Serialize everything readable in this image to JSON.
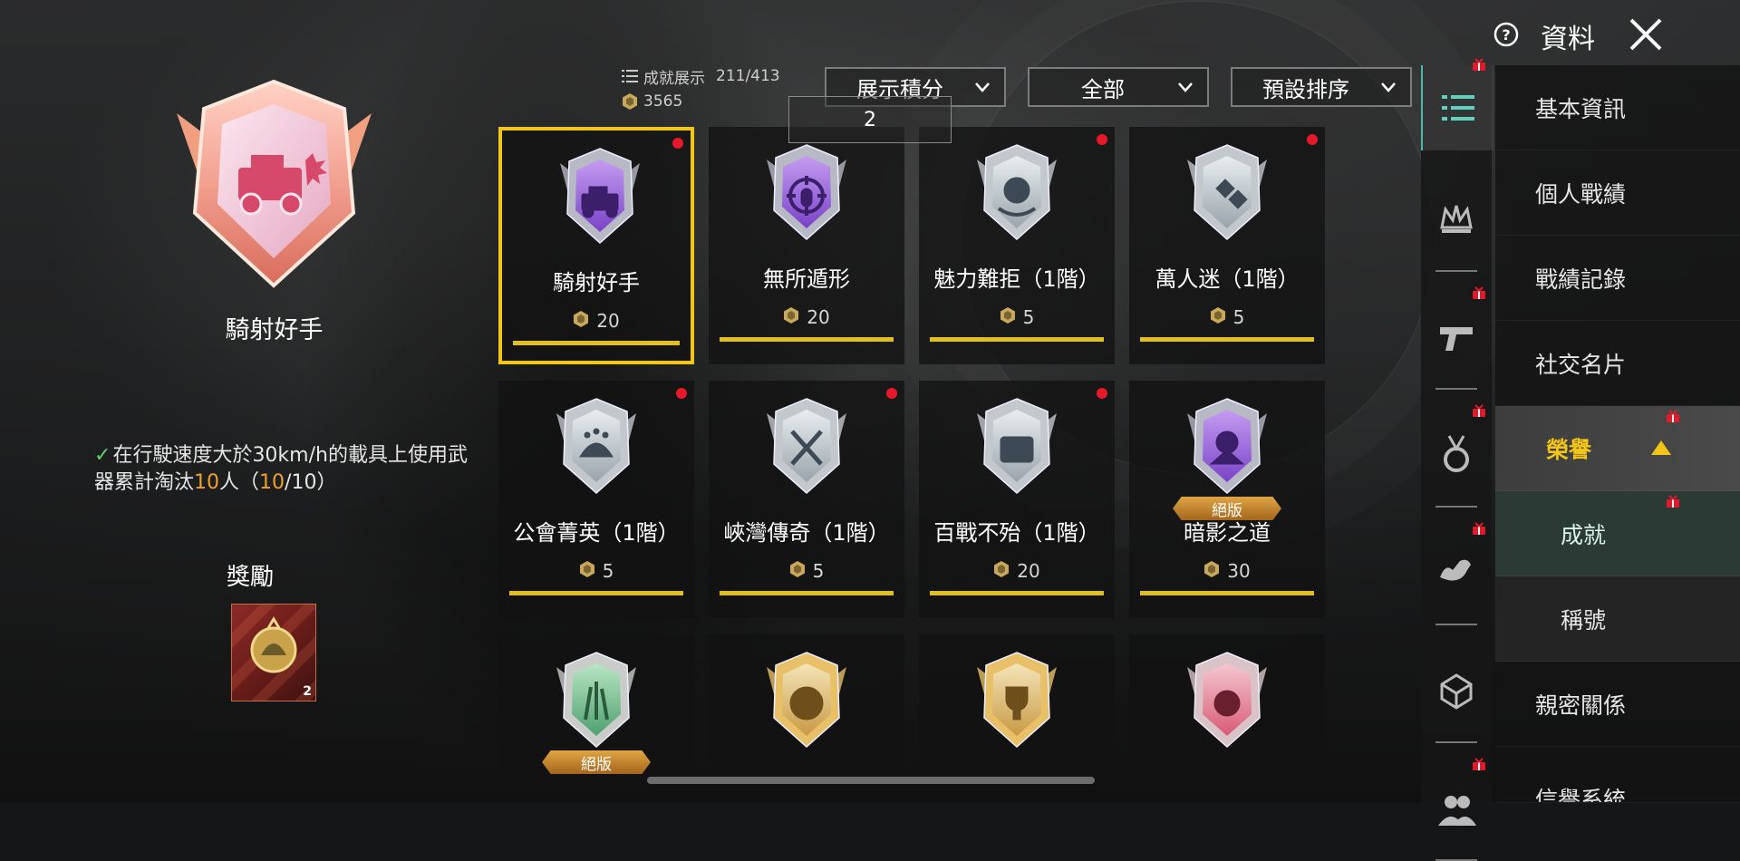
{
  "header": {
    "title": "資料"
  },
  "selected": {
    "name": "騎射好手",
    "description_pre": "在行駛速度大於30km/h的載具上使用武器累計淘汰",
    "description_count": "10",
    "description_post": "人（",
    "progress_current": "10",
    "progress_sep": "/10）",
    "reward_title": "獎勵",
    "reward_qty": "2"
  },
  "stats": {
    "label": "成就展示",
    "count": "211/413",
    "points": "3565"
  },
  "filters": {
    "sort_points": "展示積分",
    "category": "全部",
    "order": "預設排序"
  },
  "tooltip": {
    "value": "2"
  },
  "achievements": [
    {
      "name": "騎射好手",
      "points": "20",
      "new": true,
      "limited": false,
      "icon": "jeep-icon",
      "tone": "purple"
    },
    {
      "name": "無所遁形",
      "points": "20",
      "new": false,
      "limited": false,
      "icon": "crosshair-bullet-icon",
      "tone": "purple"
    },
    {
      "name": "魅力難拒（1階）",
      "points": "5",
      "new": true,
      "limited": false,
      "icon": "rp-hand-icon",
      "tone": "silver"
    },
    {
      "name": "萬人迷（1階）",
      "points": "5",
      "new": true,
      "limited": false,
      "icon": "hearts-icon",
      "tone": "silver"
    },
    {
      "name": "公會菁英（1階）",
      "points": "5",
      "new": true,
      "limited": false,
      "icon": "helmet-stars-icon",
      "tone": "silver"
    },
    {
      "name": "峽灣傳奇（1階）",
      "points": "5",
      "new": true,
      "limited": false,
      "icon": "crossed-swords-icon",
      "tone": "silver"
    },
    {
      "name": "百戰不殆（1階）",
      "points": "20",
      "new": true,
      "limited": false,
      "icon": "rp-badge-icon",
      "tone": "silver"
    },
    {
      "name": "暗影之道",
      "points": "30",
      "new": false,
      "limited": true,
      "limited_label": "絕版",
      "icon": "ninja-icon",
      "tone": "purple"
    }
  ],
  "achievements_partial": [
    {
      "limited": true,
      "limited_label": "絕版",
      "icon": "grass-icon",
      "tone": "green"
    },
    {
      "limited": false,
      "icon": "thumbs-up-icon",
      "tone": "gold"
    },
    {
      "limited": false,
      "icon": "trophy-icon",
      "tone": "gold"
    },
    {
      "limited": false,
      "icon": "gear-emblem-icon",
      "tone": "pink"
    }
  ],
  "rail": [
    {
      "icon": "list-icon",
      "active": true,
      "gift": true
    },
    {
      "icon": "crown-icon",
      "active": false,
      "gift": false
    },
    {
      "icon": "pistol-icon",
      "active": false,
      "gift": true
    },
    {
      "icon": "medal-icon",
      "active": false,
      "gift": true
    },
    {
      "icon": "muscle-icon",
      "active": false,
      "gift": true
    },
    {
      "icon": "box-icon",
      "active": false,
      "gift": false
    },
    {
      "icon": "friends-icon",
      "active": false,
      "gift": true
    }
  ],
  "menu": {
    "basic_info": "基本資訊",
    "personal_stats": "個人戰績",
    "battle_records": "戰績記錄",
    "social_card": "社交名片",
    "honor": "榮譽",
    "achievements": "成就",
    "titles": "稱號",
    "intimacy": "親密關係",
    "partial": "信譽系統"
  },
  "colors": {
    "accent_gold": "#f2c519",
    "dot_red": "#e6192a",
    "rail_active": "#4fb6a8"
  }
}
